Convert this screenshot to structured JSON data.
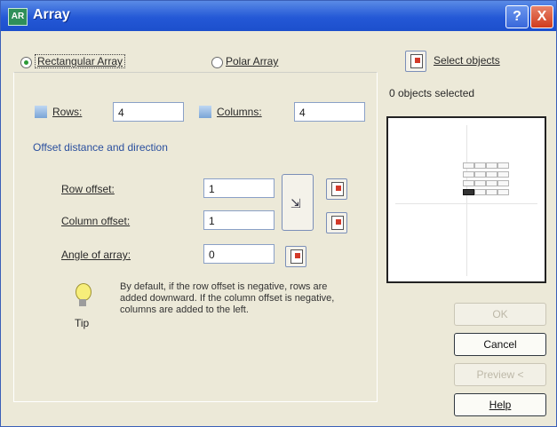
{
  "window": {
    "title": "Array",
    "title_icon": "array-app-icon",
    "help_label": "?",
    "close_label": "X"
  },
  "modes": {
    "rectangular_label": "Rectangular Array",
    "polar_label": "Polar Array",
    "selected": "rectangular"
  },
  "selection": {
    "select_objects_label": "Select objects",
    "status": "0 objects selected"
  },
  "grid": {
    "rows_label": "Rows:",
    "rows_value": "4",
    "columns_label": "Columns:",
    "columns_value": "4"
  },
  "offset": {
    "group_label": "Offset distance and direction",
    "row_offset_label": "Row offset:",
    "row_offset_value": "1",
    "column_offset_label": "Column offset:",
    "column_offset_value": "1",
    "angle_label": "Angle of array:",
    "angle_value": "0"
  },
  "tip": {
    "label": "Tip",
    "text": "By default, if the row offset is negative, rows are added downward. If the column offset is negative, columns are added to the left."
  },
  "buttons": {
    "ok": "OK",
    "cancel": "Cancel",
    "preview": "Preview <",
    "help": "Help"
  },
  "colors": {
    "titlebar": "#2458d6",
    "dialog_bg": "#ece9d8",
    "group_label": "#2a4f9e"
  }
}
